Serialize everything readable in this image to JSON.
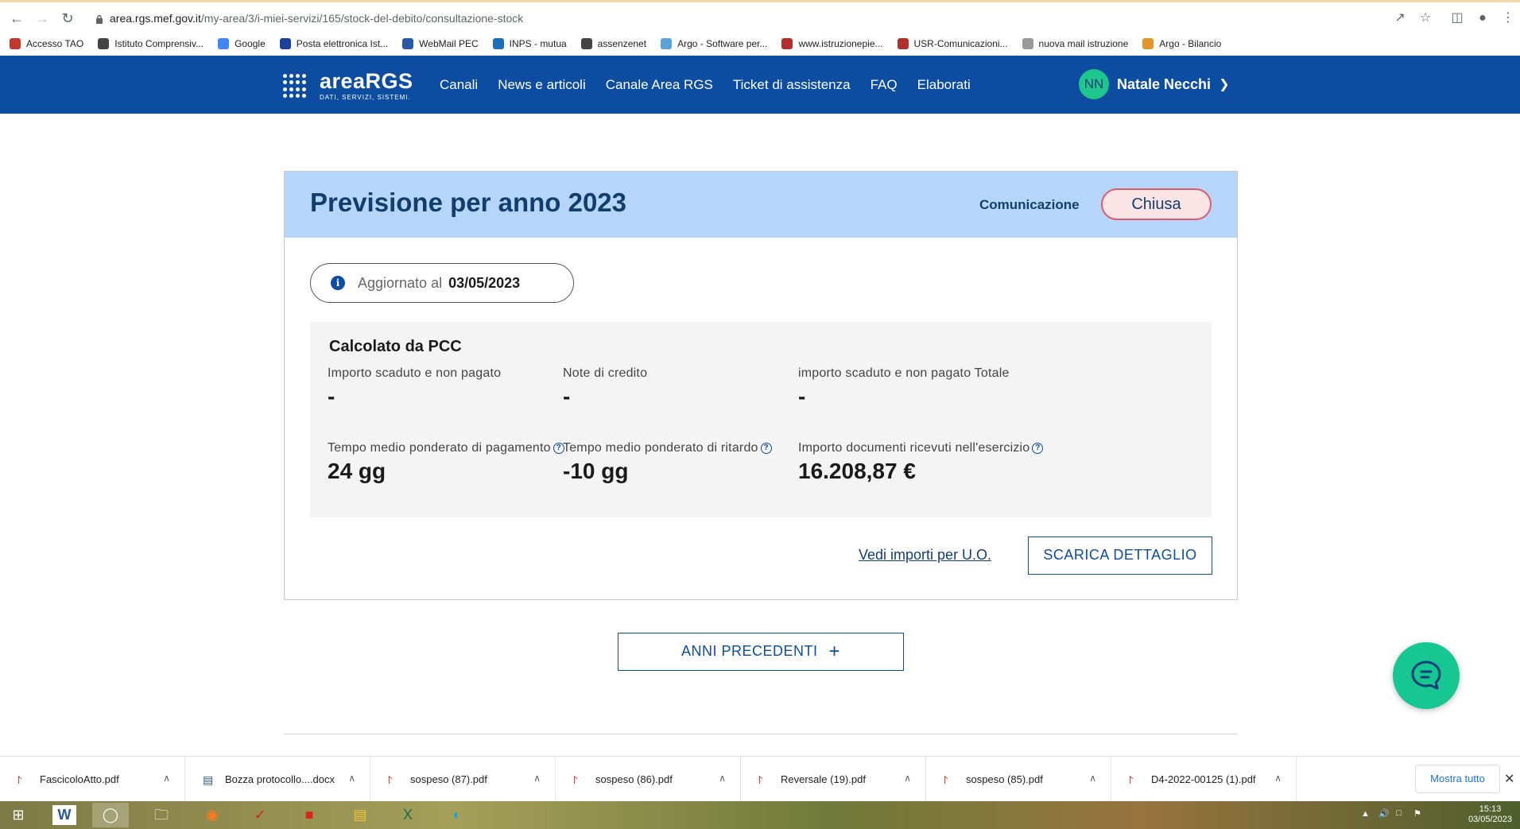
{
  "browser": {
    "url_host": "area.rgs.mef.gov.it",
    "url_path": "/my-area/3/i-miei-servizi/165/stock-del-debito/consultazione-stock",
    "bookmarks": [
      {
        "label": "Accesso TAO",
        "icon": "tao-favicon",
        "color": "#c0392b"
      },
      {
        "label": "Istituto Comprensiv...",
        "icon": "globe-favicon",
        "color": "#444444"
      },
      {
        "label": "Google",
        "icon": "google-favicon",
        "color": "#4285f4"
      },
      {
        "label": "Posta elettronica Ist...",
        "icon": "eu-flag-favicon",
        "color": "#1f3f99"
      },
      {
        "label": "WebMail PEC",
        "icon": "webmail-favicon",
        "color": "#2a5aa6"
      },
      {
        "label": "INPS - mutua",
        "icon": "inps-favicon",
        "color": "#1d6fb8"
      },
      {
        "label": "assenzenet",
        "icon": "globe-favicon",
        "color": "#444444"
      },
      {
        "label": "Argo - Software per...",
        "icon": "argo-favicon",
        "color": "#5aa2d8"
      },
      {
        "label": "www.istruzionepie...",
        "icon": "istruzione-favicon",
        "color": "#b03030"
      },
      {
        "label": "USR-Comunicazioni...",
        "icon": "usr-favicon",
        "color": "#b03030"
      },
      {
        "label": "nuova mail istruzione",
        "icon": "mail-favicon",
        "color": "#999999"
      },
      {
        "label": "Argo - Bilancio",
        "icon": "argo-bilancio-favicon",
        "color": "#e0962a"
      }
    ]
  },
  "header": {
    "brand": "areaRGS",
    "tagline": "DATI, SERVIZI, SISTEMI.",
    "nav": [
      "Canali",
      "News e articoli",
      "Canale Area RGS",
      "Ticket di assistenza",
      "FAQ",
      "Elaborati"
    ],
    "user_initials": "NN",
    "user_name": "Natale Necchi"
  },
  "card": {
    "title": "Previsione per anno 2023",
    "comm_label": "Comunicazione",
    "comm_status": "Chiusa",
    "updated_label": "Aggiornato al",
    "updated_date": "03/05/2023",
    "pcc_title": "Calcolato da PCC",
    "metrics": [
      {
        "label": "Importo scaduto e non pagato",
        "value": "-",
        "help": false
      },
      {
        "label": "Note di credito",
        "value": "-",
        "help": false
      },
      {
        "label": "importo scaduto e non pagato Totale",
        "value": "-",
        "help": false
      },
      {
        "label": "Tempo medio ponderato di pagamento",
        "value": "24 gg",
        "help": true
      },
      {
        "label": "Tempo medio ponderato di ritardo",
        "value": "-10 gg",
        "help": true
      },
      {
        "label": "Importo documenti ricevuti nell'esercizio",
        "value": "16.208,87 €",
        "help": true
      }
    ],
    "link_uo": "Vedi importi per U.O.",
    "download_label": "SCARICA DETTAGLIO"
  },
  "prev_years_label": "ANNI PRECEDENTI",
  "colors": {
    "brand_blue": "#0c4da2",
    "head_bg": "#b5d5fb",
    "status_border": "#e05a6a",
    "fab": "#16c792"
  },
  "downloads": {
    "files": [
      "FascicoloAtto.pdf",
      "Bozza protocollo....docx",
      "sospeso (87).pdf",
      "sospeso (86).pdf",
      "Reversale (19).pdf",
      "sospeso (85).pdf",
      "D4-2022-00125 (1).pdf"
    ],
    "show_all": "Mostra tutto"
  },
  "taskbar": {
    "time": "15:13",
    "date": "03/05/2023"
  }
}
